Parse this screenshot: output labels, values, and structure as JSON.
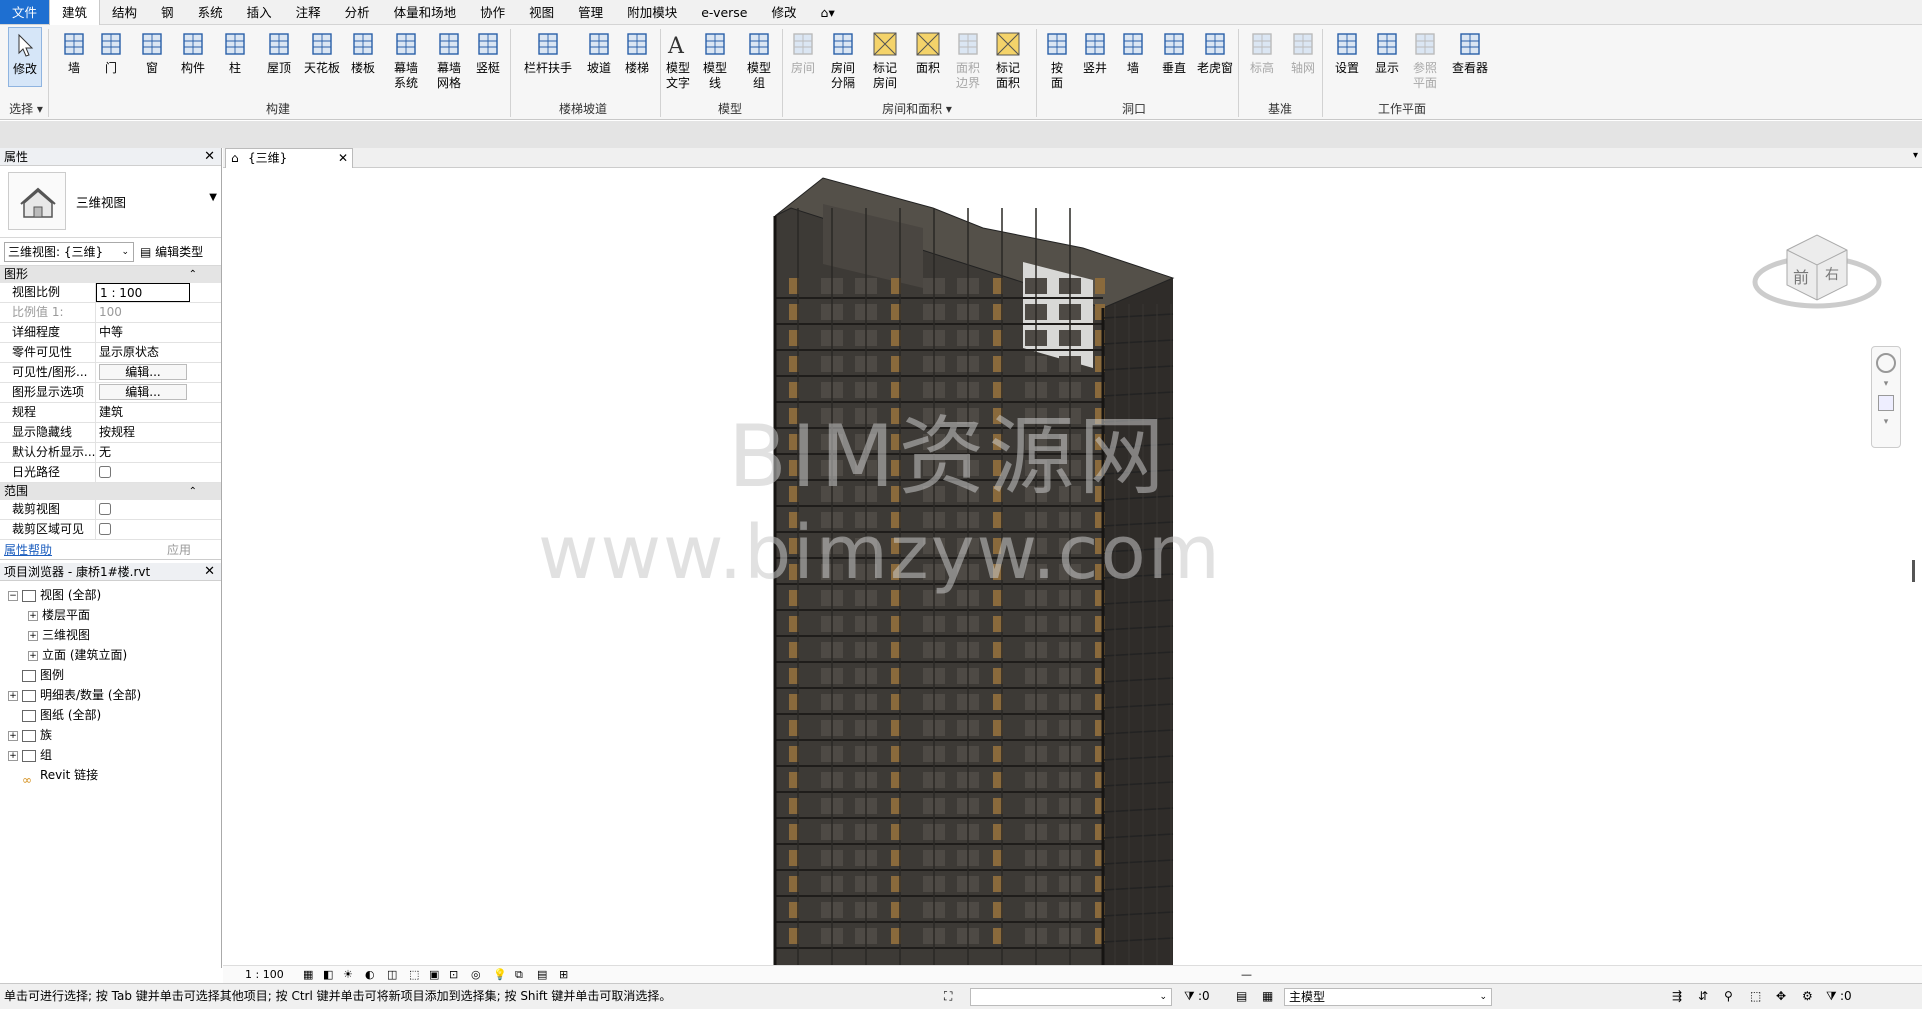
{
  "menubar": {
    "items": [
      "文件",
      "建筑",
      "结构",
      "钢",
      "系统",
      "插入",
      "注释",
      "分析",
      "体量和场地",
      "协作",
      "视图",
      "管理",
      "附加模块",
      "e-verse",
      "修改",
      "⌂▾"
    ]
  },
  "ribbon": {
    "tools": [
      {
        "label": "修改",
        "icon": "arrow-cursor-icon"
      },
      {
        "label": "墙",
        "icon": "wall-icon"
      },
      {
        "label": "门",
        "icon": "door-icon"
      },
      {
        "label": "窗",
        "icon": "window-icon"
      },
      {
        "label": "构件",
        "icon": "component-icon"
      },
      {
        "label": "柱",
        "icon": "column-icon"
      },
      {
        "label": "屋顶",
        "icon": "roof-icon"
      },
      {
        "label": "天花板",
        "icon": "ceiling-icon"
      },
      {
        "label": "楼板",
        "icon": "floor-icon"
      },
      {
        "label": "幕墙\n系统",
        "icon": "curtain-system-icon"
      },
      {
        "label": "幕墙\n网格",
        "icon": "curtain-grid-icon"
      },
      {
        "label": "竖梃",
        "icon": "mullion-icon"
      },
      {
        "label": "栏杆扶手",
        "icon": "railing-icon"
      },
      {
        "label": "坡道",
        "icon": "ramp-icon"
      },
      {
        "label": "楼梯",
        "icon": "stair-icon"
      },
      {
        "label": "模型\n文字",
        "icon": "model-text-icon"
      },
      {
        "label": "模型\n线",
        "icon": "model-line-icon"
      },
      {
        "label": "模型\n组",
        "icon": "model-group-icon"
      },
      {
        "label": "房间",
        "icon": "room-icon"
      },
      {
        "label": "房间\n分隔",
        "icon": "room-separator-icon"
      },
      {
        "label": "标记\n房间",
        "icon": "tag-room-icon"
      },
      {
        "label": "面积",
        "icon": "area-icon"
      },
      {
        "label": "面积\n边界",
        "icon": "area-boundary-icon"
      },
      {
        "label": "标记\n面积",
        "icon": "tag-area-icon"
      },
      {
        "label": "按\n面",
        "icon": "by-face-icon"
      },
      {
        "label": "竖井",
        "icon": "shaft-icon"
      },
      {
        "label": "墙",
        "icon": "wall-opening-icon"
      },
      {
        "label": "垂直",
        "icon": "vertical-opening-icon"
      },
      {
        "label": "老虎窗",
        "icon": "dormer-icon"
      },
      {
        "label": "标高",
        "icon": "level-icon"
      },
      {
        "label": "轴网",
        "icon": "grid-icon"
      },
      {
        "label": "设置",
        "icon": "set-workplane-icon"
      },
      {
        "label": "显示",
        "icon": "show-workplane-icon"
      },
      {
        "label": "参照\n平面",
        "icon": "ref-plane-icon"
      },
      {
        "label": "查看器",
        "icon": "viewer-icon"
      }
    ],
    "groups": [
      "选择 ▾",
      "构建",
      "楼梯坡道",
      "模型",
      "房间和面积 ▾",
      "洞口",
      "基准",
      "工作平面"
    ]
  },
  "properties": {
    "title": "属性",
    "close": "✕",
    "type_name": "三维视图",
    "view_selector": "三维视图: {三维}",
    "edit_type": "编辑类型",
    "cat_graphics": "图形",
    "rows": [
      {
        "k": "视图比例",
        "v": "1 : 100"
      },
      {
        "k": "比例值 1:",
        "v": "100"
      },
      {
        "k": "详细程度",
        "v": "中等"
      },
      {
        "k": "零件可见性",
        "v": "显示原状态"
      },
      {
        "k": "可见性/图形...",
        "v": "编辑..."
      },
      {
        "k": "图形显示选项",
        "v": "编辑..."
      },
      {
        "k": "规程",
        "v": "建筑"
      },
      {
        "k": "显示隐藏线",
        "v": "按规程"
      },
      {
        "k": "默认分析显示...",
        "v": "无"
      },
      {
        "k": "日光路径",
        "v": ""
      }
    ],
    "cat_extents": "范围",
    "extent_rows": [
      {
        "k": "裁剪视图",
        "v": ""
      },
      {
        "k": "裁剪区域可见",
        "v": ""
      }
    ],
    "help": "属性帮助",
    "apply": "应用"
  },
  "browser": {
    "title": "项目浏览器 - 康桥1#楼.rvt",
    "close": "✕",
    "nodes": [
      {
        "label": "视图 (全部)",
        "exp": "−"
      },
      {
        "label": "楼层平面",
        "exp": "+"
      },
      {
        "label": "三维视图",
        "exp": "+"
      },
      {
        "label": "立面 (建筑立面)",
        "exp": "+"
      },
      {
        "label": "图例",
        "exp": ""
      },
      {
        "label": "明细表/数量 (全部)",
        "exp": "+"
      },
      {
        "label": "图纸 (全部)",
        "exp": ""
      },
      {
        "label": "族",
        "exp": "+"
      },
      {
        "label": "组",
        "exp": "+"
      },
      {
        "label": "Revit 链接",
        "exp": ""
      }
    ]
  },
  "viewtab": {
    "label": "{三维}",
    "close": "✕"
  },
  "viewcube": {
    "front": "前",
    "right": "右"
  },
  "watermark": {
    "line1": "BIM资源网",
    "line2": "www.bimzyw.com"
  },
  "viewbar": {
    "scale": "1 : 100"
  },
  "status": {
    "message": "单击可进行选择; 按 Tab 键并单击可选择其他项目; 按 Ctrl 键并单击可将新项目添加到选择集; 按 Shift 键并单击可取消选择。",
    "filter_count": ":0",
    "model": "主模型",
    "select_count": ":0"
  },
  "colors": {
    "accent": "#1e6fd1",
    "building": "#3a3733",
    "window": "#8a6a3c"
  }
}
